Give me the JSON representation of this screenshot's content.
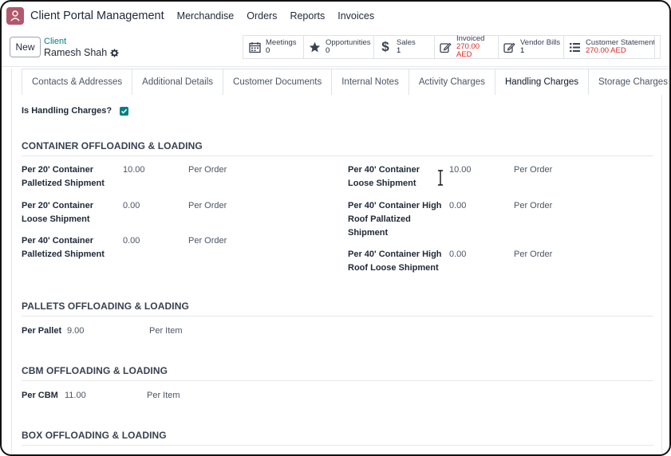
{
  "app": {
    "title": "Client Portal Management",
    "nav": [
      "Merchandise",
      "Orders",
      "Reports",
      "Invoices"
    ]
  },
  "control": {
    "new_label": "New",
    "breadcrumb_parent": "Client",
    "breadcrumb_current": "Ramesh Shah"
  },
  "smart_buttons": [
    {
      "title": "Meetings",
      "value": "0",
      "icon": "calendar-icon"
    },
    {
      "title": "Opportunities",
      "value": "0",
      "icon": "star-icon"
    },
    {
      "title": "Sales",
      "value": "1",
      "icon": "dollar-icon"
    },
    {
      "title": "Invoiced",
      "value": "270.00 AED",
      "icon": "edit-icon"
    },
    {
      "title": "Vendor Bills",
      "value": "1",
      "icon": "edit-icon"
    },
    {
      "title": "Customer Statement",
      "value": "270.00 AED",
      "icon": "list-icon",
      "value_color": "#dc2626"
    }
  ],
  "tabs": [
    "Contacts & Addresses",
    "Additional Details",
    "Customer Documents",
    "Internal Notes",
    "Activity Charges",
    "Handling Charges",
    "Storage Charges"
  ],
  "active_tab": "Handling Charges",
  "form": {
    "is_handling_label": "Is Handling Charges?",
    "is_handling_checked": true,
    "container_title": "CONTAINER OFFLOADING & LOADING",
    "container_left": [
      {
        "label_1": "Per 20' Container",
        "label_2": "Palletized Shipment",
        "value": "10.00",
        "unit": "Per Order"
      },
      {
        "label_1": "Per 20' Container",
        "label_2": "Loose Shipment",
        "value": "0.00",
        "unit": "Per Order"
      },
      {
        "label_1": "Per 40' Container",
        "label_2": "Palletized Shipment",
        "value": "0.00",
        "unit": "Per Order"
      }
    ],
    "container_right": [
      {
        "label_1": "Per 40' Container",
        "label_2": "Loose Shipment",
        "label_3": "",
        "value": "10.00",
        "unit": "Per Order"
      },
      {
        "label_1": "Per 40' Container High",
        "label_2": "Roof Pallatized",
        "label_3": "Shipment",
        "value": "0.00",
        "unit": "Per Order"
      },
      {
        "label_1": "Per 40' Container High",
        "label_2": "Roof Loose Shipment",
        "label_3": "",
        "value": "0.00",
        "unit": "Per Order"
      }
    ],
    "pallets_title": "PALLETS OFFLOADING & LOADING",
    "pallets": {
      "label": "Per Pallet",
      "value": "9.00",
      "unit": "Per Item"
    },
    "cbm_title": "CBM OFFLOADING & LOADING",
    "cbm": {
      "label": "Per CBM",
      "value": "11.00",
      "unit": "Per Item"
    },
    "box_title": "BOX OFFLOADING & LOADING"
  },
  "colors": {
    "accent": "#017e84",
    "app_icon": "#b0596d",
    "negative": "#dc2626"
  }
}
